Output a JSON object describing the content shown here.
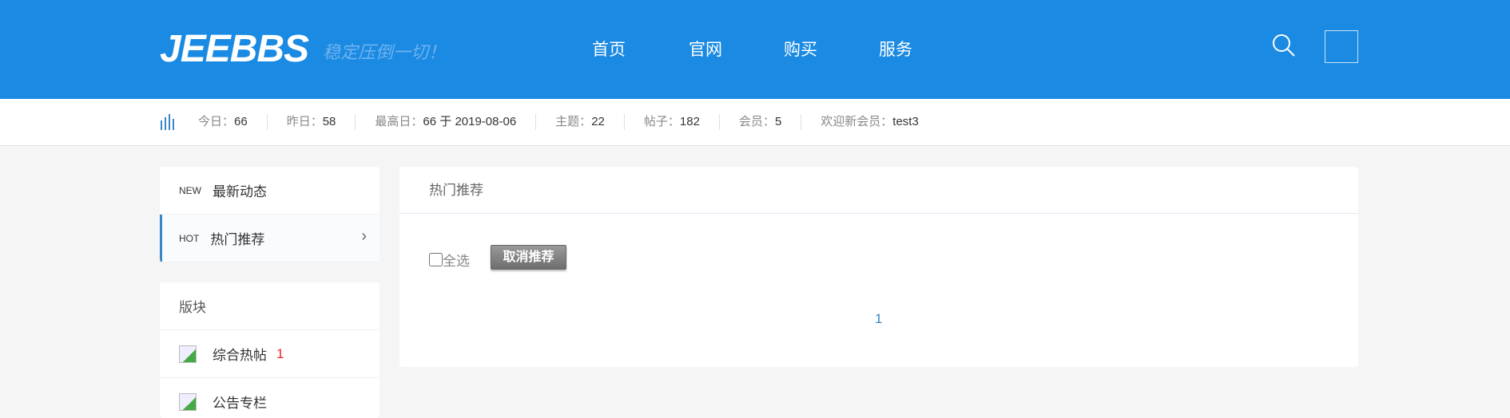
{
  "header": {
    "logo": "JEEBBS",
    "slogan": "稳定压倒一切！",
    "nav": [
      "首页",
      "官网",
      "购买",
      "服务"
    ]
  },
  "stats": [
    {
      "k": "今日：",
      "v": "66"
    },
    {
      "k": "昨日：",
      "v": "58"
    },
    {
      "k": "最高日：",
      "v": "66 于 2019-08-06"
    },
    {
      "k": "主题：",
      "v": "22"
    },
    {
      "k": "帖子：",
      "v": "182"
    },
    {
      "k": "会员：",
      "v": "5"
    },
    {
      "k": "欢迎新会员：",
      "v": "test3"
    }
  ],
  "sidebar": {
    "items": [
      {
        "tag": "NEW",
        "label": "最新动态"
      },
      {
        "tag": "HOT",
        "label": "热门推荐"
      }
    ],
    "boards_title": "版块",
    "boards": [
      {
        "label": "综合热帖",
        "count": "1"
      },
      {
        "label": "公告专栏"
      }
    ]
  },
  "main": {
    "title": "热门推荐",
    "select_all": "全选",
    "cancel_button": "取消推荐",
    "page": "1"
  }
}
